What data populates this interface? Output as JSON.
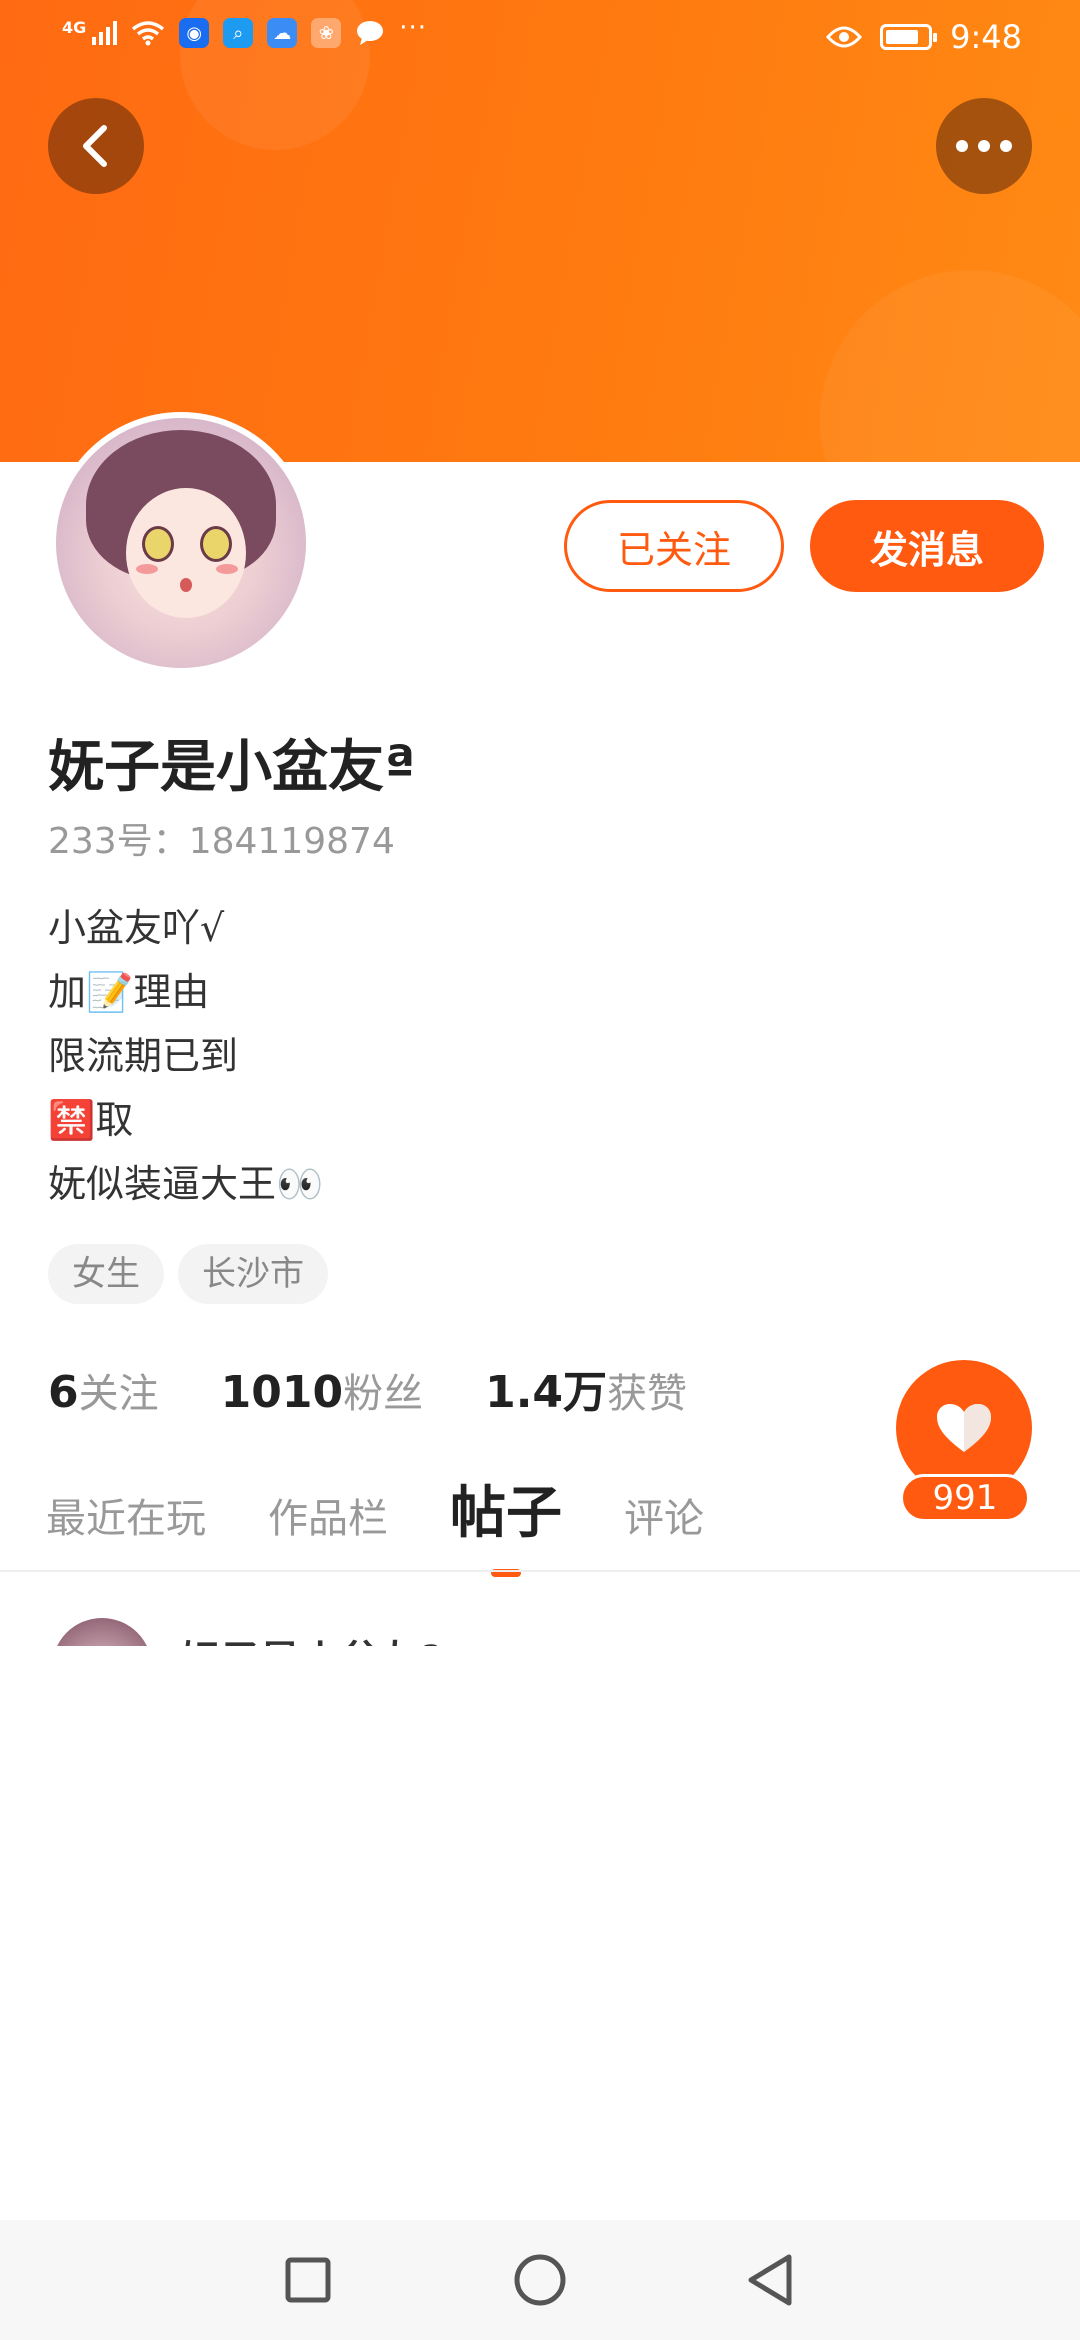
{
  "status_bar": {
    "network": "4G",
    "time": "9:48",
    "more": "···",
    "battery_level": 0.8
  },
  "header": {
    "back_icon": "chevron-left-icon",
    "more_icon": "more-dots-icon"
  },
  "profile": {
    "nickname": "妩子是小盆友ª",
    "uid": "233号：184119874",
    "bio": [
      "小盆友吖√",
      "加📝理由",
      "限流期已到",
      "🈲取",
      "妩似装逼大王👀"
    ],
    "tags": [
      "女生",
      "长沙市"
    ],
    "stats": [
      {
        "num": "6",
        "label": "关注"
      },
      {
        "num": "1010",
        "label": "粉丝"
      },
      {
        "num": "1.4万",
        "label": "获赞"
      }
    ]
  },
  "actions": {
    "followed_label": "已关注",
    "message_label": "发消息"
  },
  "like": {
    "icon": "heart-icon",
    "count": "991"
  },
  "tabs": [
    {
      "label": "最近在玩",
      "active": false
    },
    {
      "label": "作品栏",
      "active": false
    },
    {
      "label": "帖子",
      "active": true
    },
    {
      "label": "评论",
      "active": false
    }
  ],
  "post_preview": {
    "author": "妩子是小盆友ª"
  },
  "nav": {
    "recent_icon": "square-icon",
    "home_icon": "circle-icon",
    "back_icon": "triangle-back-icon"
  },
  "colors": {
    "accent": "#ff5a10",
    "header": "#ff7a10"
  }
}
